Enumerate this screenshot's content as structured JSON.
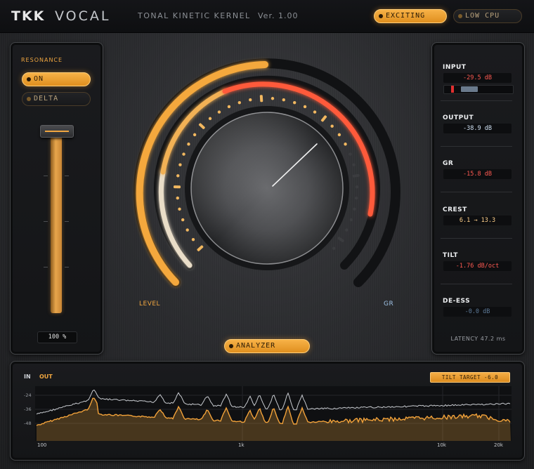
{
  "header": {
    "brand": "TKK",
    "product": "VOCAL",
    "subtitle": "TONAL KINETIC KERNEL",
    "version": "Ver. 1.00",
    "mode_buttons": [
      {
        "label": "EXCITING",
        "active": true
      },
      {
        "label": "LOW CPU",
        "active": false
      }
    ]
  },
  "resonance": {
    "title": "RESONANCE",
    "on_label": "ON",
    "on_active": true,
    "delta_label": "DELTA",
    "delta_active": false,
    "fader_value": "100 %",
    "fader_level": 1.0
  },
  "main": {
    "level_label": "LEVEL",
    "gr_label": "GR",
    "analyzer_label": "ANALYZER"
  },
  "meters": {
    "input": {
      "label": "INPUT",
      "value": "-29.5 dB",
      "color": "#ff5a52"
    },
    "output": {
      "label": "OUTPUT",
      "value": "-38.9 dB",
      "color": "#cfe0f2"
    },
    "gr": {
      "label": "GR",
      "value": "-15.8 dB",
      "color": "#ff5a52"
    },
    "crest": {
      "label": "CREST",
      "value": "6.1 → 13.3",
      "color": "#ffd08a"
    },
    "tilt": {
      "label": "TILT",
      "value": "-1.76 dB/oct",
      "color": "#ff5a52"
    },
    "deess": {
      "label": "DE-ESS",
      "value": "-0.0 dB",
      "color": "#5d7a98"
    },
    "latency": "LATENCY 47.2 ms"
  },
  "spectrum": {
    "in_label": "IN",
    "out_label": "OUT",
    "tilt_target": "TILT TARGET -6.0",
    "y_ticks": [
      "-24",
      "-36",
      "-48"
    ],
    "x_ticks": [
      "100",
      "1k",
      "10k",
      "20k"
    ]
  },
  "colors": {
    "accent": "#f0a640",
    "accent_bright": "#ffc36a",
    "gr_red": "#ff4a3a",
    "cool_blue": "#bfe0ff"
  }
}
